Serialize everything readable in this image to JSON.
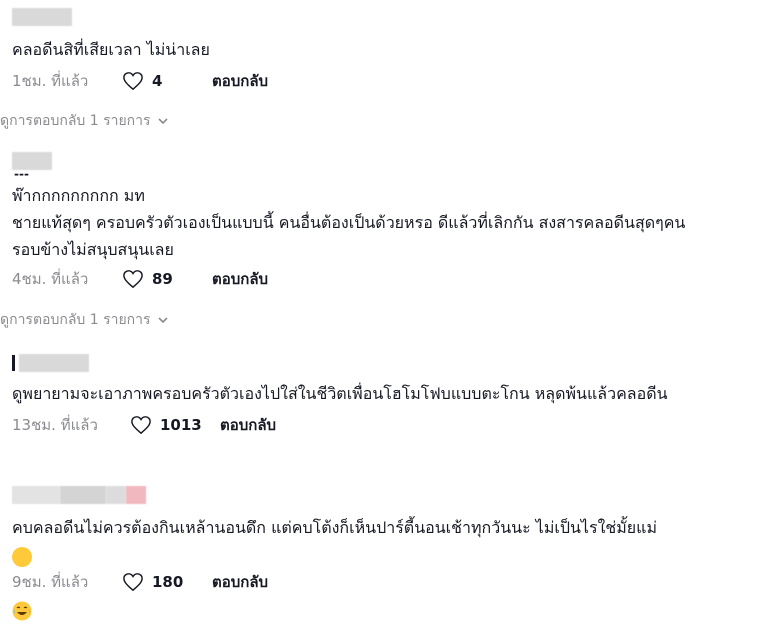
{
  "comments": [
    {
      "text": "คลอดีนสิที่เสียเวลา ไม่น่าเลย",
      "time": "1ชม. ที่แล้ว",
      "likes": "4",
      "reply_label": "ตอบกลับ",
      "view_replies": "ดูการตอบกลับ 1 รายการ"
    },
    {
      "handle_fragment": "---",
      "name": "พ๊ากกกกกกกกก มท",
      "text": "ชายแท้สุดๆ ครอบครัวตัวเองเป็นแบบนี้ คนอื่นต้องเป็นด้วยหรอ ดีแล้วที่เลิกกัน สงสารคลอดีนสุดๆคนรอบข้างไม่สนุบสนุนเลย",
      "time": "4ชม. ที่แล้ว",
      "likes": "89",
      "reply_label": "ตอบกลับ",
      "view_replies": "ดูการตอบกลับ 1 รายการ"
    },
    {
      "text": "ดูพยายามจะเอาภาพครอบครัวตัวเองไปใส่ในชีวิตเพื่อนโฮโมโฟบแบบตะโกน หลุดพ้นแล้วคลอดีน",
      "time": "13ชม. ที่แล้ว",
      "likes": "1013",
      "reply_label": "ตอบกลับ"
    },
    {
      "text": "คบคลอดีนไม่ควรต้องกินเหล้านอนดึก แต่คบโต้งก็เห็นปาร์ตี้นอนเช้าทุกวันนะ ไม่เป็นไรใช่มั้ยแม่",
      "emoji": "😂",
      "time": "9ชม. ที่แล้ว",
      "likes": "180",
      "reply_label": "ตอบกลับ"
    }
  ],
  "colors": {
    "text": "#161823",
    "muted": "#8a8b91",
    "blur_gray": "#d9d9d9",
    "blur_pink": "#f2b8c0"
  },
  "icons": {
    "like": "heart-outline-icon",
    "expand": "chevron-down-icon"
  }
}
